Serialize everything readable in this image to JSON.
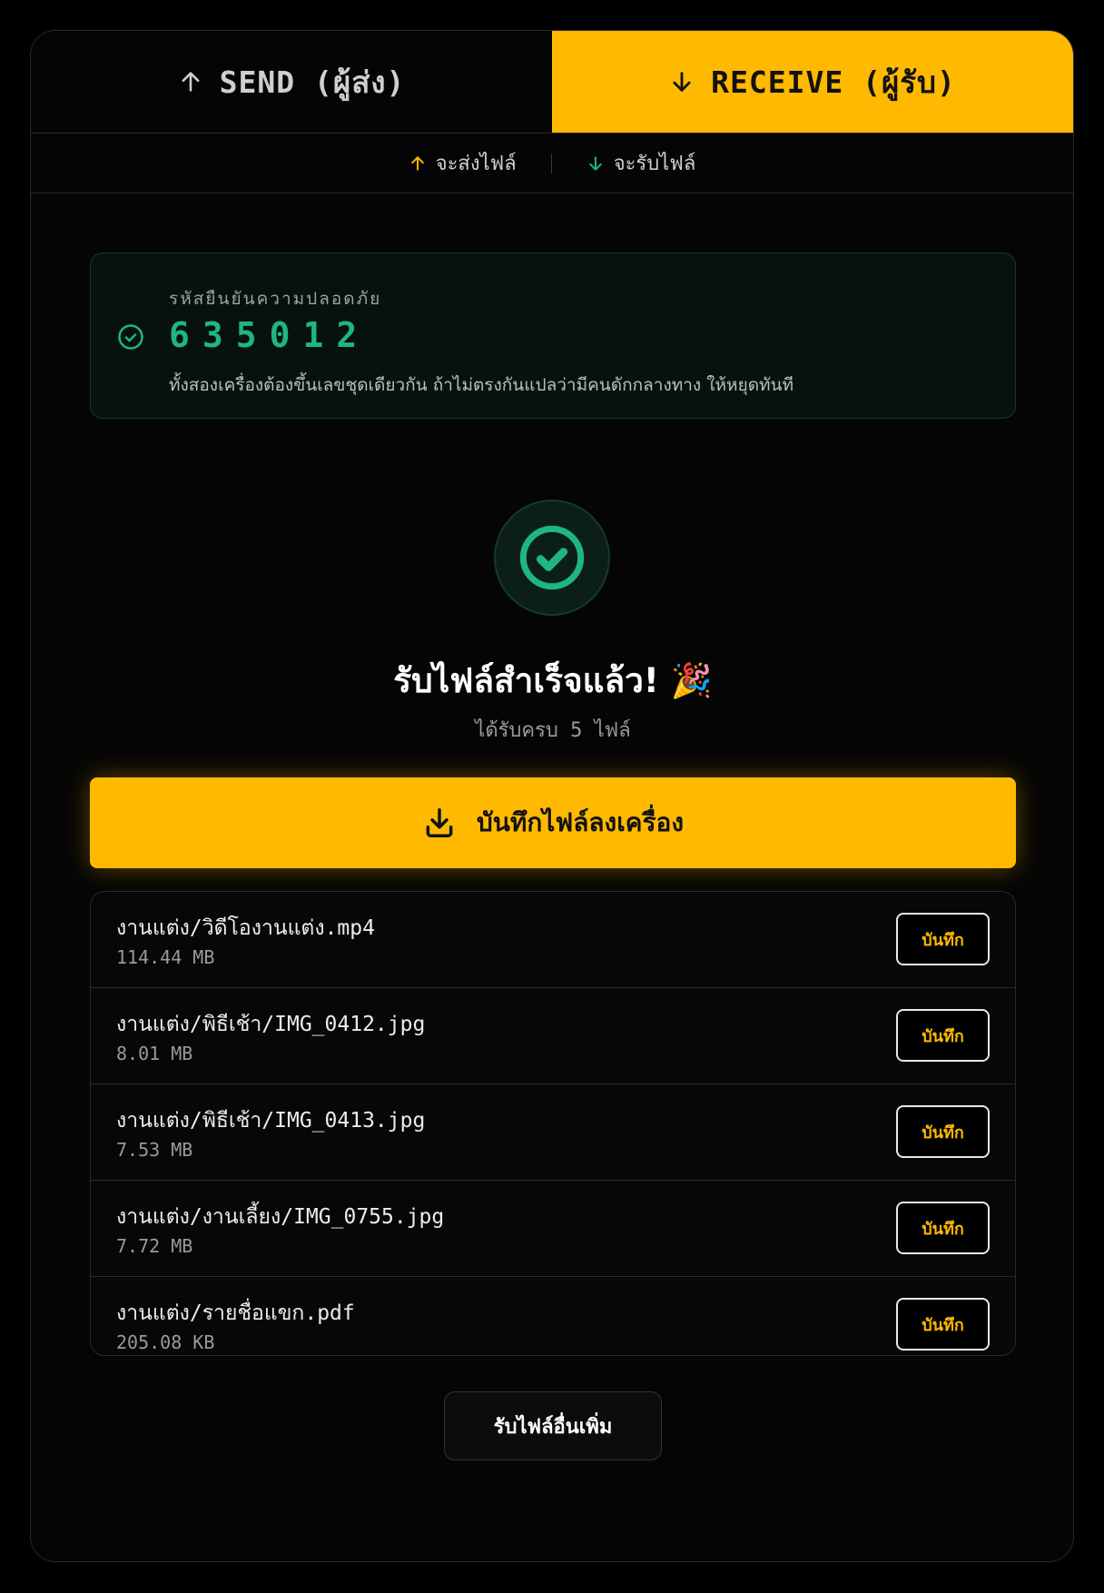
{
  "tabs": {
    "send_label": "SEND (ผู้ส่ง)",
    "receive_label": "RECEIVE (ผู้รับ)",
    "send_icon": "arrow-up-icon",
    "receive_icon": "arrow-down-icon"
  },
  "subbar": {
    "send_label": "จะส่งไฟล์",
    "receive_label": "จะรับไฟล์"
  },
  "verification": {
    "label": "รหัสยืนยันความปลอดภัย",
    "code": "635012",
    "hint": "ทั้งสองเครื่องต้องขึ้นเลขชุดเดียวกัน ถ้าไม่ตรงกันแปลว่ามีคนดักกลางทาง ให้หยุดทันที",
    "icon": "check-circle-icon"
  },
  "status": {
    "title": "รับไฟล์สำเร็จแล้ว! 🎉",
    "subtitle": "ได้รับครบ 5 ไฟล์"
  },
  "save_all": {
    "label": "บันทึกไฟล์ลงเครื่อง",
    "icon": "download-icon"
  },
  "files": [
    {
      "name": "งานแต่ง/วิดีโองานแต่ง.mp4",
      "size": "114.44 MB",
      "button": "บันทึก"
    },
    {
      "name": "งานแต่ง/พิธีเช้า/IMG_0412.jpg",
      "size": "8.01 MB",
      "button": "บันทึก"
    },
    {
      "name": "งานแต่ง/พิธีเช้า/IMG_0413.jpg",
      "size": "7.53 MB",
      "button": "บันทึก"
    },
    {
      "name": "งานแต่ง/งานเลี้ยง/IMG_0755.jpg",
      "size": "7.72 MB",
      "button": "บันทึก"
    },
    {
      "name": "งานแต่ง/รายชื่อแขก.pdf",
      "size": "205.08 KB",
      "button": "บันทึก"
    }
  ],
  "more_button": "รับไฟล์อื่นเพิ่ม",
  "colors": {
    "accent": "#FFB900",
    "success": "#1FB680",
    "background": "#000000"
  }
}
